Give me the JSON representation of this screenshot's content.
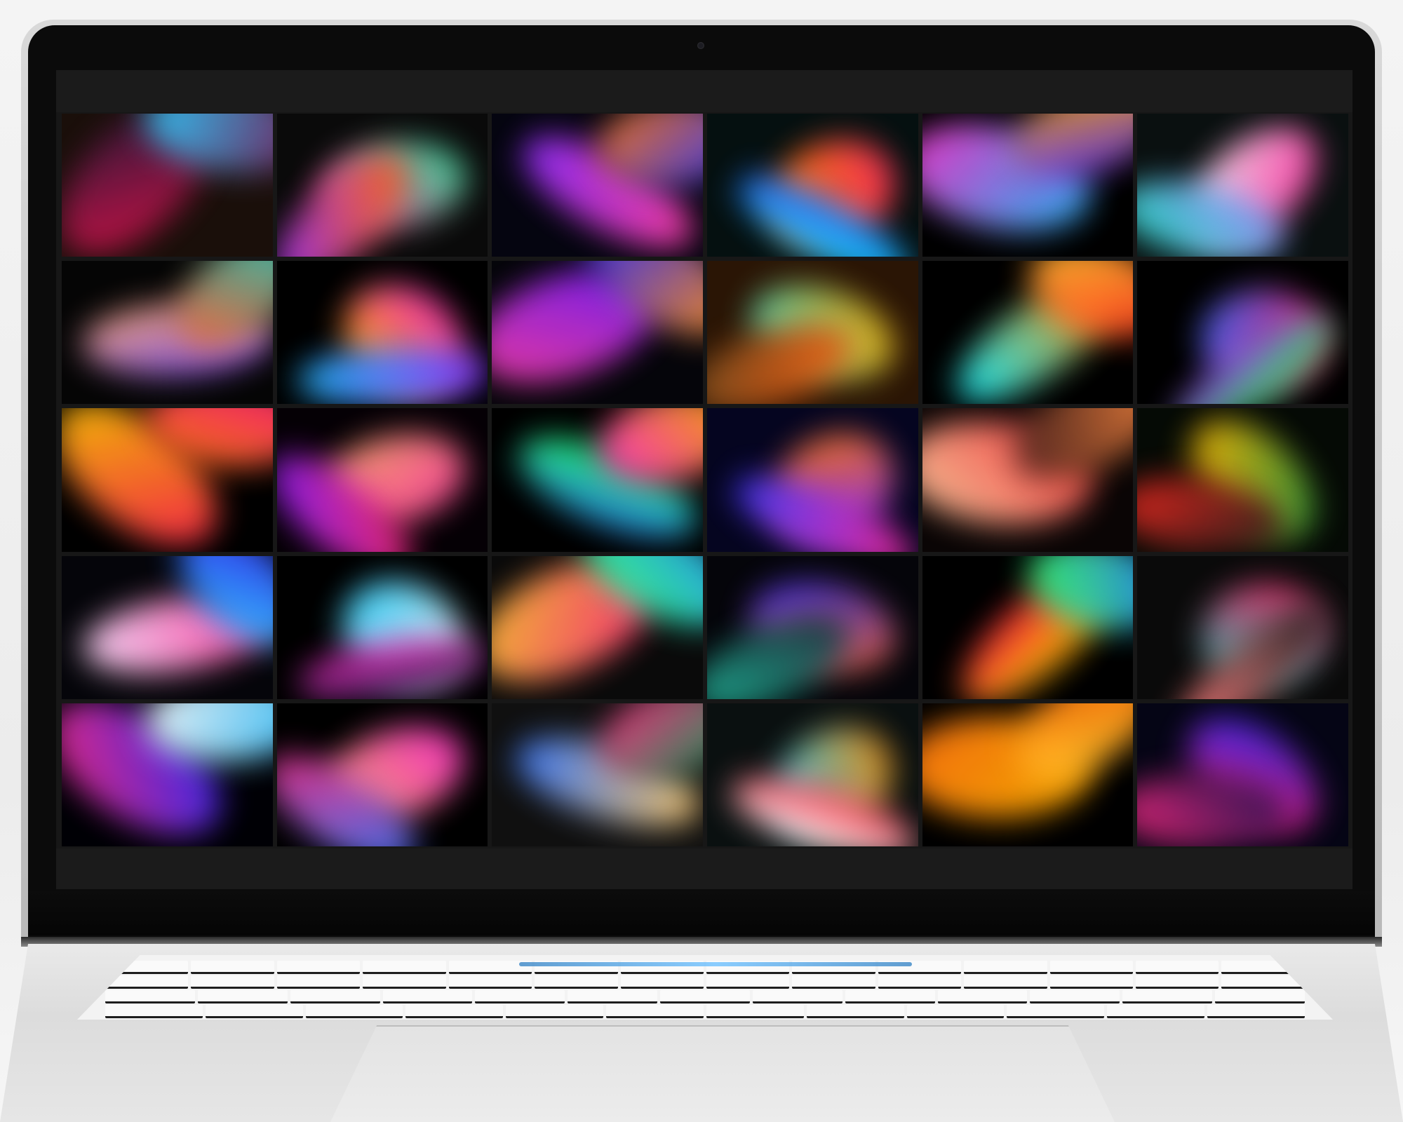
{
  "device": "laptop",
  "screen": {
    "view": "image-gallery",
    "background": "#171717",
    "grid": {
      "columns": 6,
      "rows": 5
    },
    "tiles": [
      {
        "name": "thumb-1",
        "bg": "#1a0f0a",
        "blobs": [
          [
            "#e0114a",
            "#1a1a3a"
          ],
          [
            "#2bd0ff",
            "#7a1a5a"
          ]
        ]
      },
      {
        "name": "thumb-2",
        "bg": "#0a0a0a",
        "blobs": [
          [
            "#ff2d95",
            "#2cf0a0"
          ],
          [
            "#9a2cff",
            "#ff6a00"
          ]
        ]
      },
      {
        "name": "thumb-3",
        "bg": "#050510",
        "blobs": [
          [
            "#8a2cff",
            "#ff3fa0"
          ],
          [
            "#ff7a10",
            "#3a3aff"
          ]
        ]
      },
      {
        "name": "thumb-4",
        "bg": "#051010",
        "blobs": [
          [
            "#ff8a00",
            "#ff2a60"
          ],
          [
            "#2a4aff",
            "#10f0ff"
          ]
        ]
      },
      {
        "name": "thumb-5",
        "bg": "#000000",
        "blobs": [
          [
            "#ff2dcb",
            "#20c0ff"
          ],
          [
            "#ffb000",
            "#5a2aff"
          ]
        ]
      },
      {
        "name": "thumb-6",
        "bg": "#0a1010",
        "blobs": [
          [
            "#ffffff",
            "#ff2aa0"
          ],
          [
            "#9a8aff",
            "#20e0c0"
          ]
        ]
      },
      {
        "name": "thumb-7",
        "bg": "#050505",
        "blobs": [
          [
            "#ffb070",
            "#7a4aff"
          ],
          [
            "#20d0c0",
            "#ff5a2a"
          ]
        ]
      },
      {
        "name": "thumb-8",
        "bg": "#000000",
        "blobs": [
          [
            "#ff2dcb",
            "#ffb000"
          ],
          [
            "#8a2cff",
            "#20c0ff"
          ]
        ]
      },
      {
        "name": "thumb-9",
        "bg": "#05050a",
        "blobs": [
          [
            "#6a1aff",
            "#ff3fa0"
          ],
          [
            "#ff9020",
            "#2a2aff"
          ]
        ]
      },
      {
        "name": "thumb-10",
        "bg": "#2a1505",
        "blobs": [
          [
            "#ffb000",
            "#40d0c0"
          ],
          [
            "#ff6010",
            "#6a4a20"
          ]
        ]
      },
      {
        "name": "thumb-11",
        "bg": "#000000",
        "blobs": [
          [
            "#ff8a00",
            "#10f0ff"
          ],
          [
            "#ff2a20",
            "#ffcc30"
          ]
        ]
      },
      {
        "name": "thumb-12",
        "bg": "#000000",
        "blobs": [
          [
            "#ff1a60",
            "#3a6aff"
          ],
          [
            "#20ff40",
            "#a02aff"
          ]
        ]
      },
      {
        "name": "thumb-13",
        "bg": "#000000",
        "blobs": [
          [
            "#ff1a50",
            "#ffd000"
          ],
          [
            "#ff7a10",
            "#ff1a80"
          ]
        ]
      },
      {
        "name": "thumb-14",
        "bg": "#050005",
        "blobs": [
          [
            "#ff3fa0",
            "#ffb070"
          ],
          [
            "#7a1aff",
            "#ff2a60"
          ]
        ]
      },
      {
        "name": "thumb-15",
        "bg": "#000000",
        "blobs": [
          [
            "#2a7aff",
            "#20ff60"
          ],
          [
            "#ff2dcb",
            "#ffb000"
          ]
        ]
      },
      {
        "name": "thumb-16",
        "bg": "#050520",
        "blobs": [
          [
            "#8a2cff",
            "#ff7a10"
          ],
          [
            "#3a3aff",
            "#ff2aa0"
          ]
        ]
      },
      {
        "name": "thumb-17",
        "bg": "#0a0505",
        "blobs": [
          [
            "#ffd0a0",
            "#ff3a40"
          ],
          [
            "#3a1a1a",
            "#ff8a40"
          ]
        ]
      },
      {
        "name": "thumb-18",
        "bg": "#050a05",
        "blobs": [
          [
            "#ffb000",
            "#2aa040"
          ],
          [
            "#ff2a20",
            "#1a1a1a"
          ]
        ]
      },
      {
        "name": "thumb-19",
        "bg": "#05050a",
        "blobs": [
          [
            "#ffe0ff",
            "#ff3fa0"
          ],
          [
            "#3a2aff",
            "#2ad0ff"
          ]
        ]
      },
      {
        "name": "thumb-20",
        "bg": "#000000",
        "blobs": [
          [
            "#2ad0ff",
            "#ffffff"
          ],
          [
            "#ff2dcb",
            "#1a1a3a"
          ]
        ]
      },
      {
        "name": "thumb-21",
        "bg": "#0a0a0a",
        "blobs": [
          [
            "#ffcc30",
            "#ff2a80"
          ],
          [
            "#2aa0ff",
            "#30ff80"
          ]
        ]
      },
      {
        "name": "thumb-22",
        "bg": "#05050a",
        "blobs": [
          [
            "#2a2aff",
            "#ff6a2a"
          ],
          [
            "#1a1a2a",
            "#20c0a0"
          ]
        ]
      },
      {
        "name": "thumb-23",
        "bg": "#000000",
        "blobs": [
          [
            "#ff1a40",
            "#ffd000"
          ],
          [
            "#2a7aff",
            "#30ff60"
          ]
        ]
      },
      {
        "name": "thumb-24",
        "bg": "#0a0a0a",
        "blobs": [
          [
            "#ff1a60",
            "#20d0c0"
          ],
          [
            "#1a1a1a",
            "#ff8080"
          ]
        ]
      },
      {
        "name": "thumb-25",
        "bg": "#000005",
        "blobs": [
          [
            "#2a2aff",
            "#ff2a80"
          ],
          [
            "#30c0ff",
            "#ffffff"
          ]
        ]
      },
      {
        "name": "thumb-26",
        "bg": "#000000",
        "blobs": [
          [
            "#ff2dcb",
            "#ffb070"
          ],
          [
            "#2a7aff",
            "#ff2a80"
          ]
        ]
      },
      {
        "name": "thumb-27",
        "bg": "#101010",
        "blobs": [
          [
            "#ffcc70",
            "#3a7aff"
          ],
          [
            "#20a060",
            "#ff2a80"
          ]
        ]
      },
      {
        "name": "thumb-28",
        "bg": "#0a1010",
        "blobs": [
          [
            "#ff8a00",
            "#2ad0ff"
          ],
          [
            "#ffffff",
            "#ff2a40"
          ]
        ]
      },
      {
        "name": "thumb-29",
        "bg": "#000000",
        "blobs": [
          [
            "#ffb000",
            "#ff7010"
          ],
          [
            "#ffd030",
            "#ff5a00"
          ]
        ]
      },
      {
        "name": "thumb-30",
        "bg": "#050515",
        "blobs": [
          [
            "#ff1a60",
            "#2a2aff"
          ],
          [
            "#ff2a80",
            "#10104a"
          ]
        ]
      }
    ]
  }
}
